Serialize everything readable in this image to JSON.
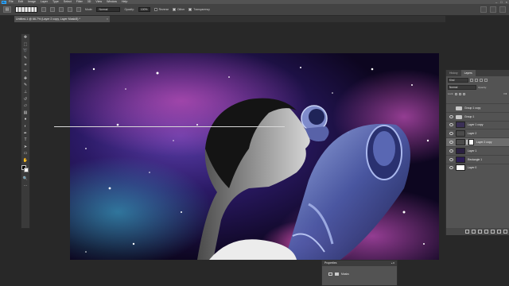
{
  "menubar": {
    "app_logo": "Ps",
    "items": [
      "File",
      "Edit",
      "Image",
      "Layer",
      "Type",
      "Select",
      "Filter",
      "3D",
      "View",
      "Window",
      "Help"
    ],
    "controls": [
      "–",
      "□",
      "×"
    ]
  },
  "options": {
    "mode_label": "Mode:",
    "mode_value": "Normal",
    "opacity_label": "Opacity:",
    "opacity_value": "100%",
    "reverse_label": "Reverse",
    "dither_label": "Dither",
    "transparency_label": "Transparency",
    "reverse_checked": false,
    "dither_checked": true,
    "transparency_checked": true
  },
  "document": {
    "tab_title": "Untitled-1 @ 66.7% (Layer 2 copy, Layer Mask/8) *",
    "close_glyph": "×"
  },
  "toolbox": {
    "tools": [
      {
        "name": "move-tool-icon",
        "glyph": "✥"
      },
      {
        "name": "marquee-tool-icon",
        "glyph": "⬚"
      },
      {
        "name": "lasso-tool-icon",
        "glyph": "➰"
      },
      {
        "name": "quick-select-tool-icon",
        "glyph": "✎"
      },
      {
        "name": "crop-tool-icon",
        "glyph": "⌗"
      },
      {
        "name": "eyedropper-tool-icon",
        "glyph": "✑"
      },
      {
        "name": "healing-brush-icon",
        "glyph": "✚"
      },
      {
        "name": "brush-tool-icon",
        "glyph": "✎"
      },
      {
        "name": "clone-stamp-icon",
        "glyph": "⊥"
      },
      {
        "name": "history-brush-icon",
        "glyph": "↺"
      },
      {
        "name": "eraser-tool-icon",
        "glyph": "▱"
      },
      {
        "name": "gradient-tool-icon",
        "glyph": "▤"
      },
      {
        "name": "blur-tool-icon",
        "glyph": "●"
      },
      {
        "name": "dodge-tool-icon",
        "glyph": "◐"
      },
      {
        "name": "pen-tool-icon",
        "glyph": "✒"
      },
      {
        "name": "type-tool-icon",
        "glyph": "T"
      },
      {
        "name": "path-select-icon",
        "glyph": "➤"
      },
      {
        "name": "shape-tool-icon",
        "glyph": "▭"
      },
      {
        "name": "hand-tool-icon",
        "glyph": "✋"
      },
      {
        "name": "zoom-tool-icon",
        "glyph": "🔍"
      },
      {
        "name": "more-tools-icon",
        "glyph": "…"
      }
    ]
  },
  "layers": {
    "tab_history": "History",
    "tab_layers": "Layers",
    "kind_label": "Kind",
    "blend_mode": "Normal",
    "opacity_label": "Opacity:",
    "lock_label": "Lock:",
    "fill_label": "Fill:",
    "rows": [
      {
        "name": "Group 1 copy",
        "type": "folder",
        "visible": false,
        "selected": false
      },
      {
        "name": "Group 1",
        "type": "folder",
        "visible": true,
        "selected": false
      },
      {
        "name": "Layer 1 copy",
        "type": "image",
        "visible": true,
        "selected": false,
        "color": "#3a2f55"
      },
      {
        "name": "Layer 2",
        "type": "image",
        "visible": true,
        "selected": false,
        "color": "#4b4b4b"
      },
      {
        "name": "Layer 2 copy",
        "type": "image-mask",
        "visible": true,
        "selected": true,
        "color": "#4a4a4a"
      },
      {
        "name": "Layer 1",
        "type": "image",
        "visible": true,
        "selected": false,
        "color": "#2a2040"
      },
      {
        "name": "Rectangle 1",
        "type": "image",
        "visible": true,
        "selected": false,
        "color": "#2b1d55"
      },
      {
        "name": "Layer 0",
        "type": "image",
        "visible": true,
        "selected": false,
        "color": "#ffffff"
      }
    ]
  },
  "properties": {
    "title": "Properties",
    "ctrl": "» ≡",
    "row_label": "Masks"
  },
  "colors": {
    "panel_bg": "#535353",
    "app_bg": "#282828",
    "accent": "#31a8ff"
  }
}
